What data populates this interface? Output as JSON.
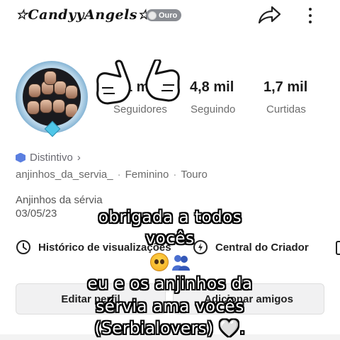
{
  "header": {
    "username": "☆CandyyAngels☆",
    "badge_label": "Ouro",
    "share_icon": "share-arrow-icon",
    "more_icon": "more-vertical-icon"
  },
  "profile": {
    "avatar_icon": "profile-avatar",
    "stats": [
      {
        "value": "1 mil",
        "label": "Seguidores"
      },
      {
        "value": "4,8 mil",
        "label": "Seguindo"
      },
      {
        "value": "1,7 mil",
        "label": "Curtidas"
      }
    ],
    "distintivo": "Distintivo",
    "distintivo_chevron": "›",
    "handle": "anjinhos_da_servia_",
    "gender": "Feminino",
    "sign": "Touro",
    "separator": "·",
    "bio_line1": "Anjinhos da sérvia",
    "bio_line2": "03/05/23"
  },
  "actions": {
    "history": "Histórico de visualizações",
    "creator": "Central do Criador",
    "edit": "Editar perfil",
    "add_friends": "Adicionar amigos"
  },
  "caption": {
    "line1": "obrigada a todos",
    "line2": "vocês",
    "line3": "eu e os anjinhos da",
    "line4": "sérvia ama vocês",
    "line5": "(Serbialovers)",
    "heart": "🤍",
    "end": "."
  },
  "colors": {
    "badge_gray": "#8a8d93",
    "distintivo_blue": "#5b7fe0",
    "avatar_ring": "#7fb0d2"
  }
}
